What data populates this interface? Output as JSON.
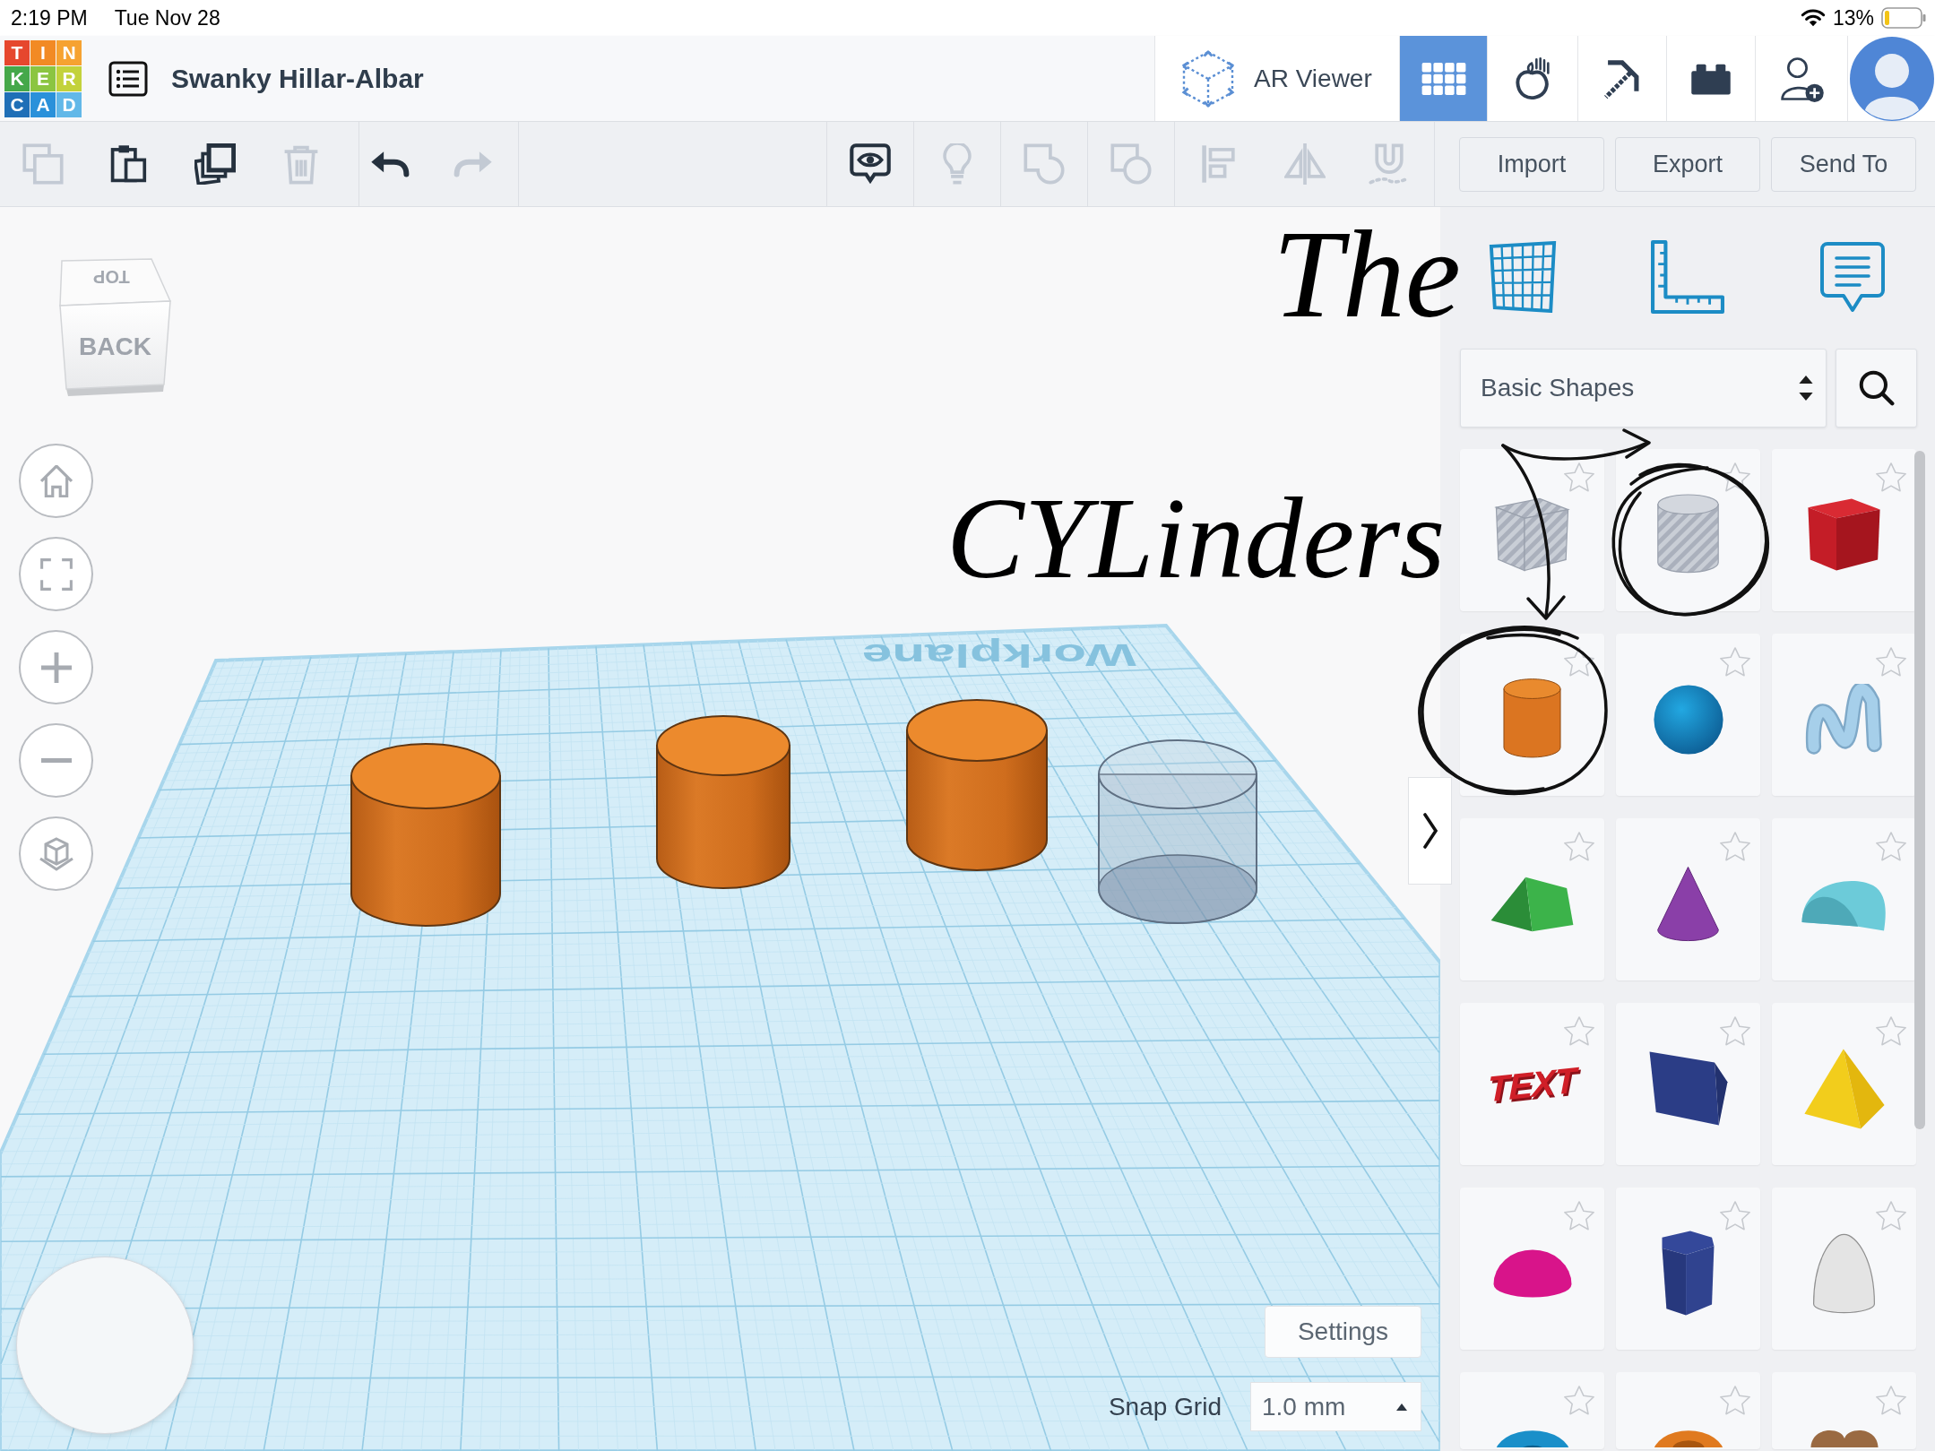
{
  "status_bar": {
    "time": "2:19 PM",
    "date": "Tue Nov 28",
    "battery": "13%"
  },
  "header": {
    "logo": [
      {
        "letter": "T",
        "color": "#e6472e"
      },
      {
        "letter": "I",
        "color": "#f28a24"
      },
      {
        "letter": "N",
        "color": "#f6a231"
      },
      {
        "letter": "K",
        "color": "#45a84a"
      },
      {
        "letter": "E",
        "color": "#8bc541"
      },
      {
        "letter": "R",
        "color": "#c3d23b"
      },
      {
        "letter": "C",
        "color": "#1f6fb7"
      },
      {
        "letter": "A",
        "color": "#2a91da"
      },
      {
        "letter": "D",
        "color": "#62b8e8"
      }
    ],
    "title": "Swanky Hillar-Albar",
    "ar_viewer": "AR Viewer",
    "view_buttons": [
      {
        "kind": "grid",
        "selected": true
      },
      {
        "kind": "apple",
        "selected": false
      },
      {
        "kind": "pickaxe",
        "selected": false
      },
      {
        "kind": "brick",
        "selected": false
      }
    ]
  },
  "toolbar": {
    "edit_tools": [
      {
        "kind": "copy",
        "disabled": true
      },
      {
        "kind": "paste",
        "disabled": false
      },
      {
        "kind": "duplicate",
        "disabled": false
      },
      {
        "kind": "delete",
        "disabled": true
      }
    ],
    "history_tools": [
      {
        "kind": "undo",
        "disabled": false
      },
      {
        "kind": "redo",
        "disabled": true
      }
    ],
    "shape_tools": [
      {
        "kind": "notes",
        "disabled": false
      },
      {
        "kind": "bulb",
        "disabled": true
      },
      {
        "kind": "group",
        "disabled": true
      },
      {
        "kind": "ungroup",
        "disabled": true
      }
    ],
    "arrange_tools": [
      {
        "kind": "align",
        "disabled": true
      },
      {
        "kind": "mirror",
        "disabled": true
      },
      {
        "kind": "magnet",
        "disabled": true
      }
    ],
    "buttons": [
      "Import",
      "Export",
      "Send To"
    ]
  },
  "view_cube": {
    "top": "TOP",
    "front": "BACK"
  },
  "workplane": {
    "label": "Workplane",
    "shapes": [
      {
        "kind": "solid"
      },
      {
        "kind": "solid"
      },
      {
        "kind": "solid"
      },
      {
        "kind": "hole"
      }
    ]
  },
  "grid_settings": {
    "settings": "Settings",
    "snap_label": "Snap Grid",
    "snap_value": "1.0 mm"
  },
  "shape_panel": {
    "category": "Basic Shapes",
    "shapes": [
      {
        "kind": "box_hole",
        "starred": false
      },
      {
        "kind": "cylinder_hole",
        "starred": false
      },
      {
        "kind": "box",
        "starred": false
      },
      {
        "kind": "cylinder",
        "starred": false
      },
      {
        "kind": "sphere",
        "starred": false
      },
      {
        "kind": "scribble",
        "starred": false
      },
      {
        "kind": "roof",
        "starred": false
      },
      {
        "kind": "cone",
        "starred": false
      },
      {
        "kind": "round_roof",
        "starred": false
      },
      {
        "kind": "text",
        "label": "TEXT",
        "starred": false
      },
      {
        "kind": "wedge",
        "starred": false
      },
      {
        "kind": "pyramid",
        "starred": false
      },
      {
        "kind": "half_sphere",
        "starred": false
      },
      {
        "kind": "polygon",
        "starred": false
      },
      {
        "kind": "paraboloid",
        "starred": false
      },
      {
        "kind": "torus",
        "starred": false
      },
      {
        "kind": "tube",
        "starred": false
      },
      {
        "kind": "heart",
        "starred": false
      }
    ]
  },
  "annotation": {
    "lines": [
      "The",
      "CYLinders"
    ]
  }
}
